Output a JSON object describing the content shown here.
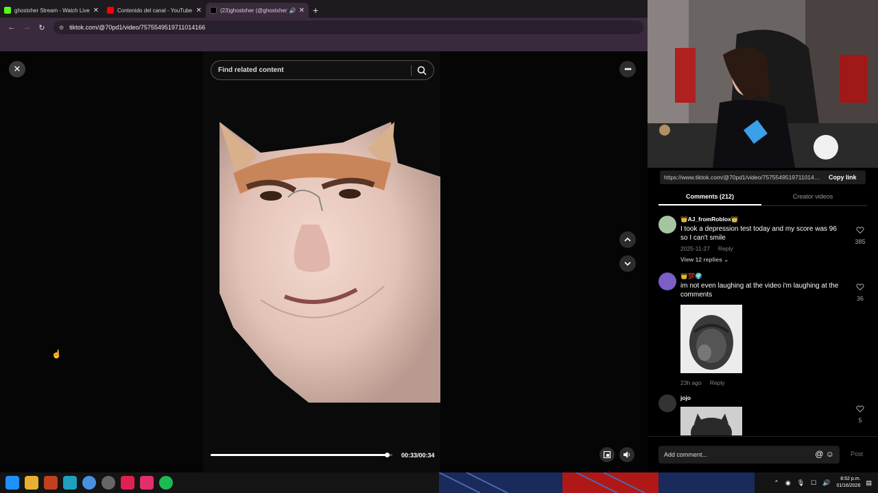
{
  "browser": {
    "tabs": [
      {
        "label": "ghostxher Stream - Watch Live",
        "favicon_color": "#53fc18"
      },
      {
        "label": "Contenido del canal - YouTube",
        "favicon_color": "#ff0000"
      },
      {
        "label": "(23)ghostxher (@ghostxher)",
        "favicon_color": "#ffffff"
      }
    ],
    "new_tab": "+",
    "url": "tiktok.com/@70pd1/video/7575549519711014166"
  },
  "viewer": {
    "search_placeholder": "Find related content",
    "time": "00:33/00:34",
    "progress": 0.97
  },
  "panel": {
    "share_url": "https://www.tiktok.com/@70pd1/video/7575549519711014166",
    "copy_link": "Copy link",
    "tabs": [
      "Comments (212)",
      "Creator videos"
    ],
    "comments": [
      {
        "name": "👑AJ_fromRoblox👑",
        "text": "I took a depression test today and my score was 96 so I can't smile",
        "date": "2025-11-27",
        "reply": "Reply",
        "likes": "385",
        "view_replies": "View 12 replies ⌄",
        "avatar_color": "#a7c4a0"
      },
      {
        "name": "👑💯🌍",
        "text": "im not even laughing at the video i'm laughing at the comments",
        "date": "23h ago",
        "reply": "Reply",
        "likes": "36",
        "avatar_color": "#7b5fc7"
      },
      {
        "name": "jojo",
        "likes": "5",
        "avatar_color": "#333333"
      }
    ],
    "add_comment": "Add comment...",
    "post": "Post"
  },
  "taskbar": {
    "time": "8:52 p.m.",
    "date": "01/16/2026"
  }
}
